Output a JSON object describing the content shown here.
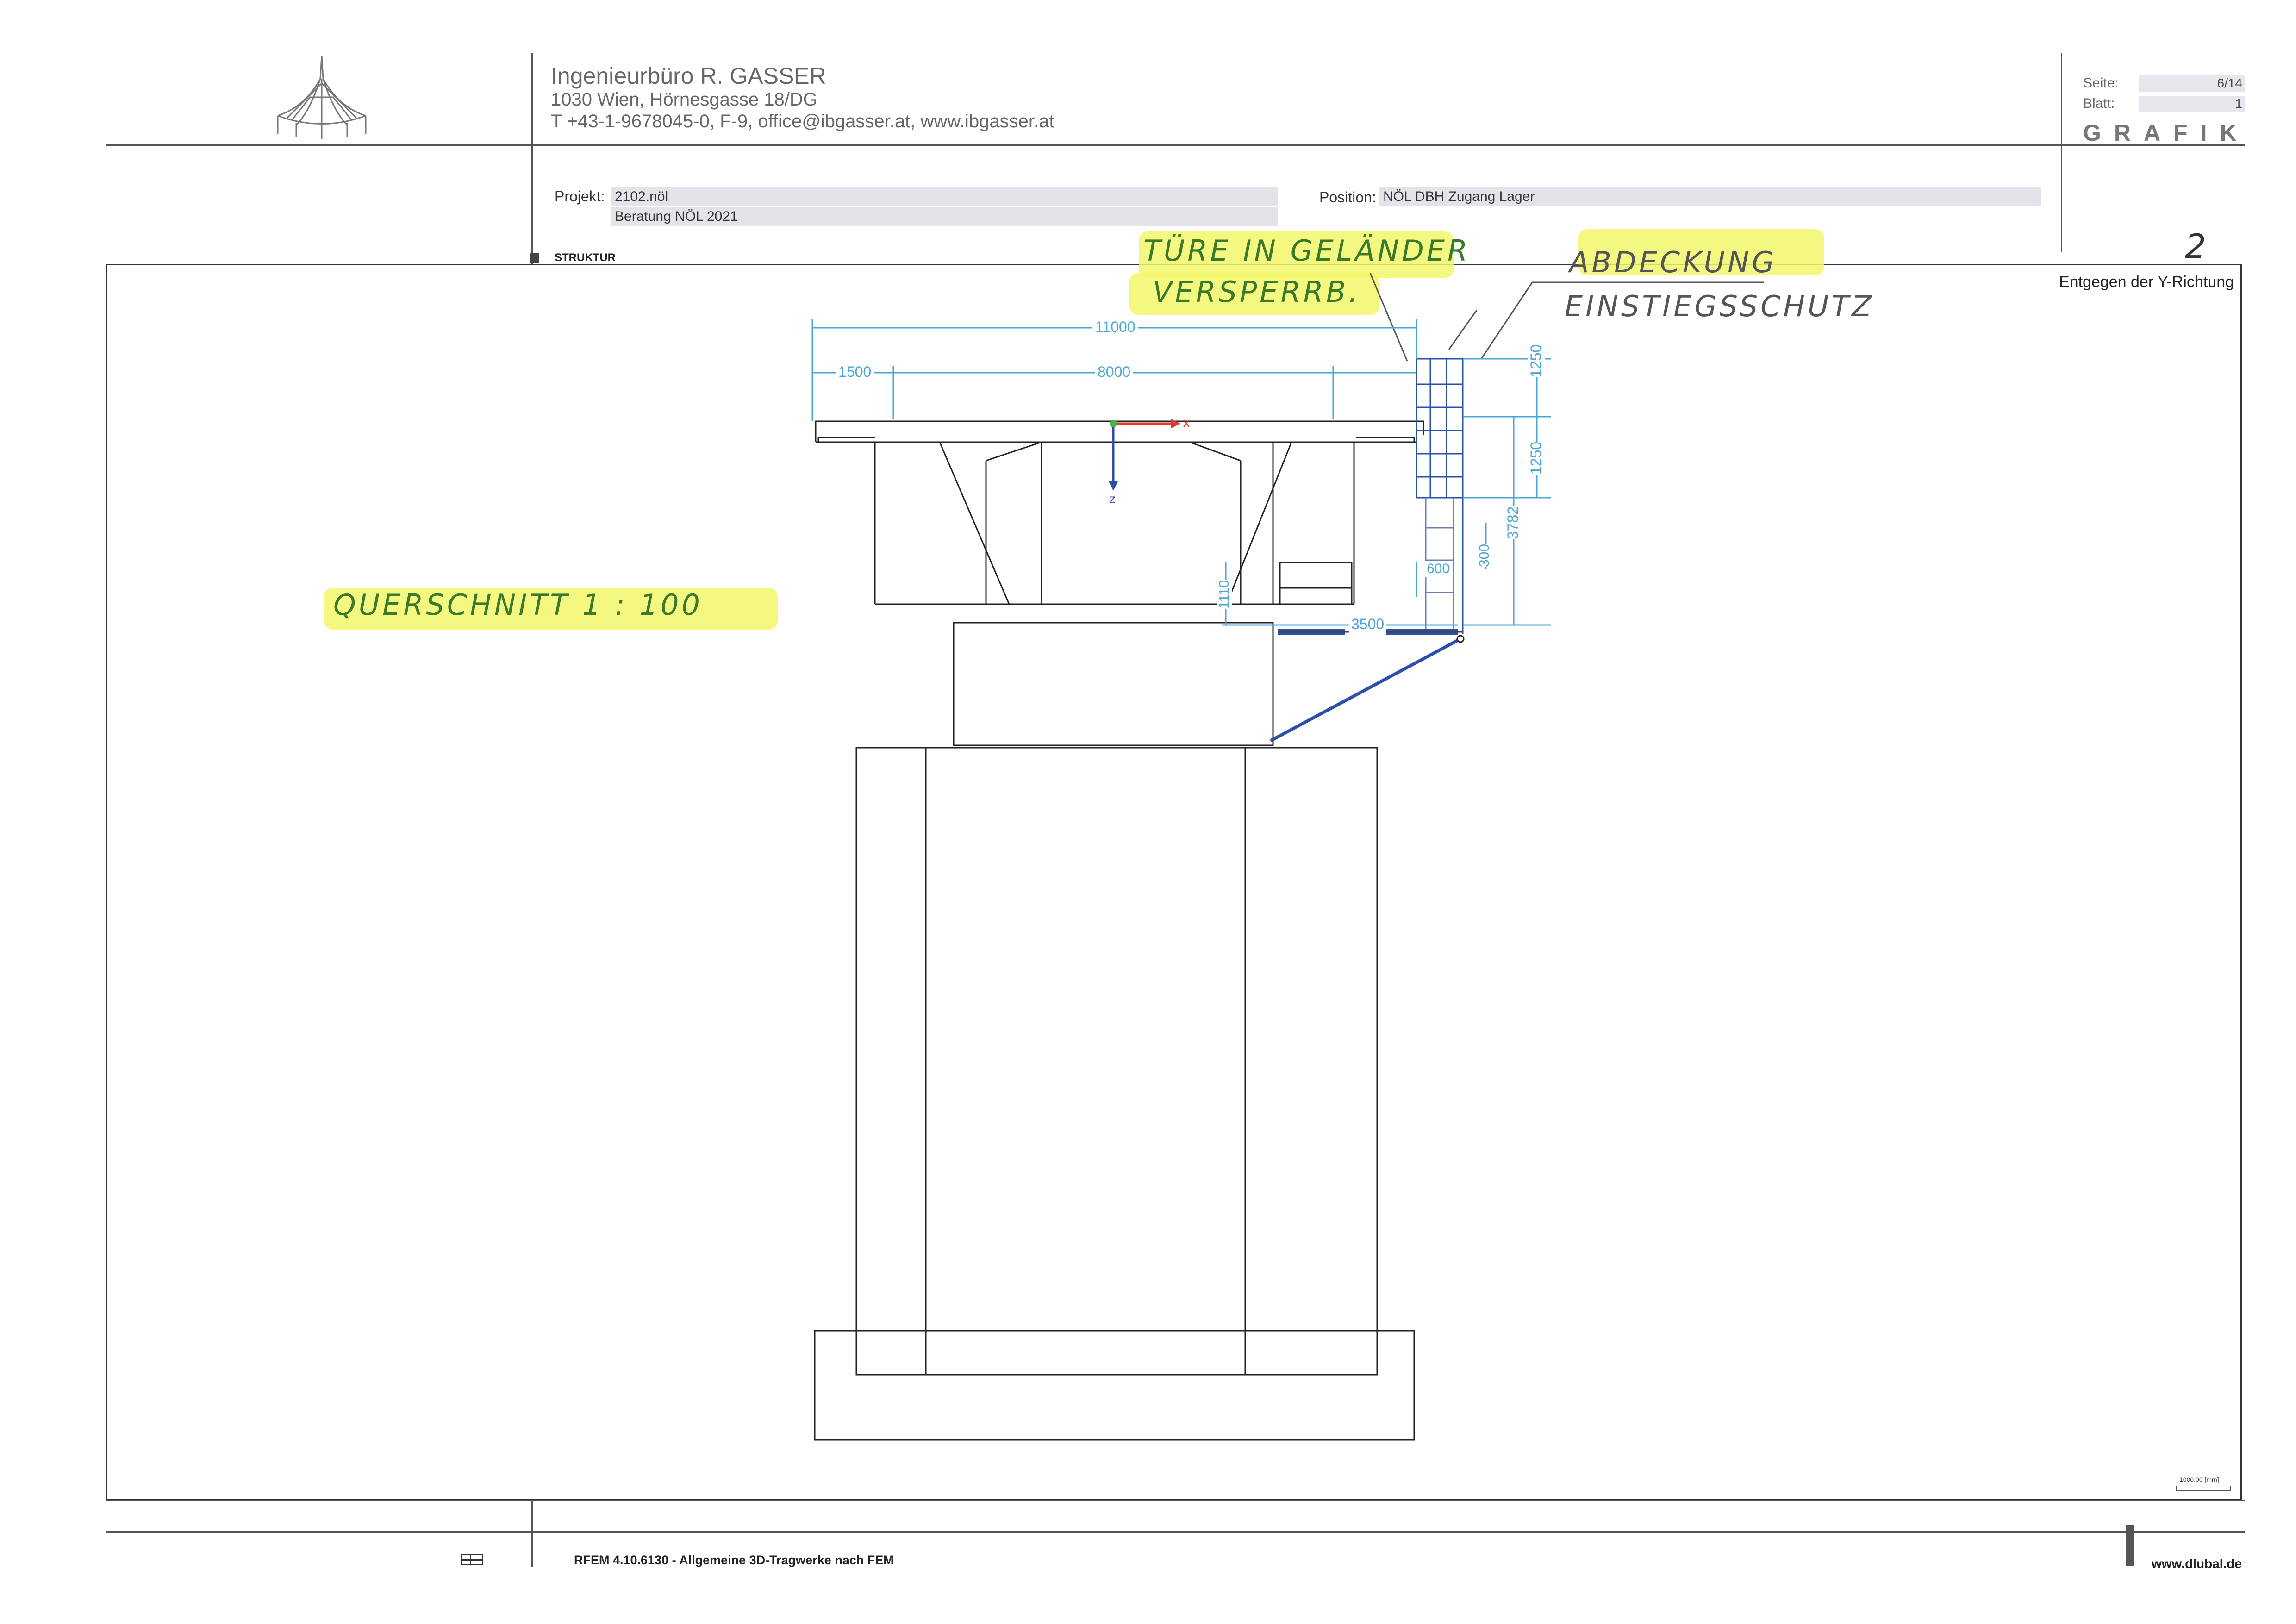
{
  "header": {
    "firm_name": "Ingenieurbüro R. GASSER",
    "address": "1030 Wien, Hörnesgasse 18/DG",
    "contact": "T +43-1-9678045-0,  F-9,  office@ibgasser.at,  www.ibgasser.at",
    "seite_label": "Seite:",
    "seite_value": "6/14",
    "blatt_label": "Blatt:",
    "blatt_value": "1",
    "section_title": "GRAFIK"
  },
  "project": {
    "projekt_label": "Projekt:",
    "projekt_value": "2102.nöl",
    "projekt_sub": "Beratung NÖL 2021",
    "position_label": "Position:",
    "position_value": "NÖL DBH Zugang Lager",
    "struktur_label": "STRUKTUR"
  },
  "drawing": {
    "view_label": "Entgegen der Y-Richtung",
    "dimensions": {
      "overall": "11000",
      "left": "1500",
      "middle": "8000",
      "right_top": "1250",
      "right_mid": "1250",
      "right_total": "3782",
      "right_small": "300",
      "platform_width": "3500",
      "platform_height": "1110",
      "inner_600": "600"
    },
    "axis_x": "x",
    "axis_z": "z",
    "scale_bar": "1000.00 [mm]"
  },
  "annotations": {
    "note1_line1": "TÜRE IN GELÄNDER",
    "note1_line2": "VERSPERRB.",
    "note2_line1": "ABDECKUNG",
    "note2_line2": "EINSTIEGSSCHUTZ",
    "section": "QUERSCHNITT   1 : 100",
    "page_number": "2"
  },
  "footer": {
    "software": "RFEM 4.10.6130 - Allgemeine 3D-Tragwerke nach FEM",
    "website": "www.dlubal.de"
  },
  "colors": {
    "dimension_blue": "#4aa6d6",
    "highlight_yellow": "#f3f76a",
    "handwriting_green": "#3a7a2a",
    "axis_red": "#e03a2a",
    "axis_blue": "#2c4fa8"
  }
}
